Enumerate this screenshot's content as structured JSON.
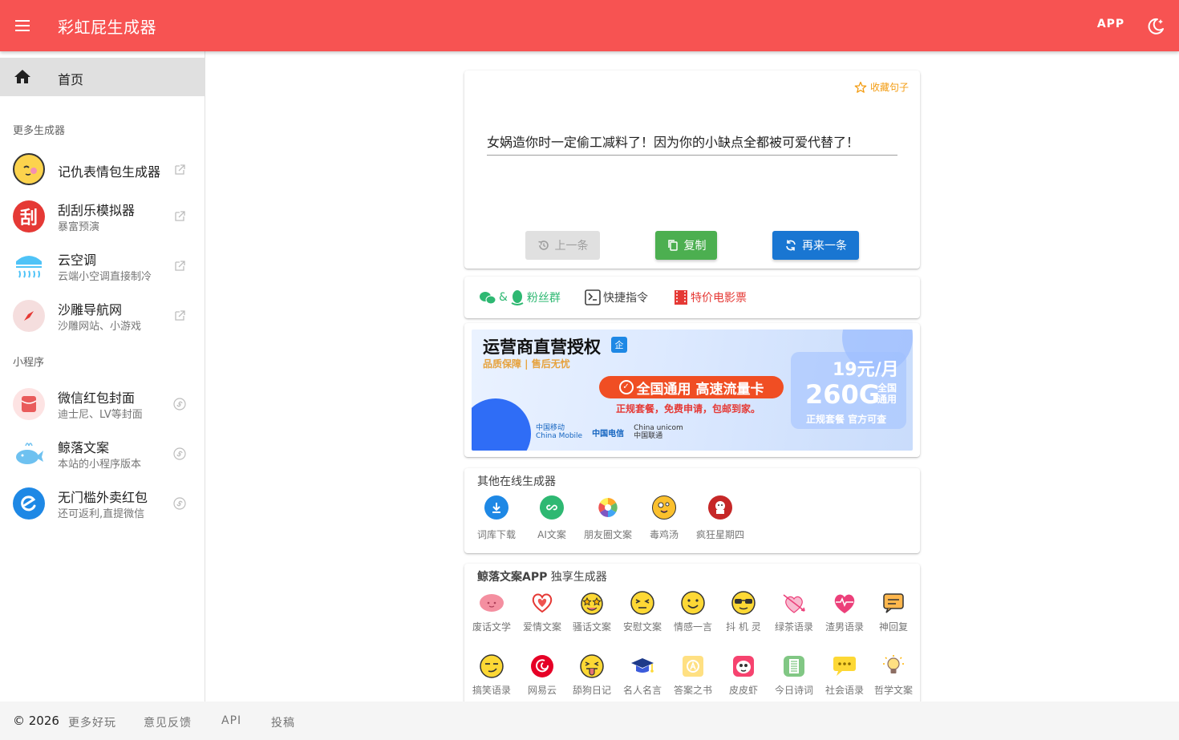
{
  "header": {
    "title": "彩虹屁生成器",
    "app_label": "APP"
  },
  "sidebar": {
    "home_label": "首页",
    "more_generators_header": "更多生成器",
    "generators": [
      {
        "title": "记仇表情包生成器",
        "sub": ""
      },
      {
        "title": "刮刮乐模拟器",
        "sub": "暴富预演",
        "avatar_text": "刮"
      },
      {
        "title": "云空调",
        "sub": "云端小空调直接制冷"
      },
      {
        "title": "沙雕导航网",
        "sub": "沙雕网站、小游戏"
      }
    ],
    "mini_programs_header": "小程序",
    "mini_programs": [
      {
        "title": "微信红包封面",
        "sub": "迪士尼、LV等封面"
      },
      {
        "title": "鲸落文案",
        "sub": "本站的小程序版本"
      },
      {
        "title": "无门槛外卖红包",
        "sub": "还可返利,直提微信"
      }
    ]
  },
  "main": {
    "favorite_label": "收藏句子",
    "sentence": "女娲造你时一定偷工减料了！因为你的小缺点全都被可爱代替了！",
    "prev_label": "上一条",
    "copy_label": "复制",
    "again_label": "再来一条",
    "links": {
      "fans_amp": "&",
      "fans_label": "粉丝群",
      "shortcut_label": "快捷指令",
      "movie_label": "特价电影票"
    }
  },
  "ad": {
    "headline": "运营商直营授权",
    "badge": "企",
    "guarantee": "品质保障 | 售后无忧",
    "pill": "全国通用 高速流量卡",
    "subline": "正规套餐，免费申请，包邮到家。",
    "price": "19元/月",
    "data_amount": "260G",
    "data_tag_1": "全国",
    "data_tag_2": "通用",
    "price_note": "正规套餐 官方可查",
    "carrier_1": "中国移动",
    "carrier_1_en": "China Mobile",
    "carrier_2": "中国电信",
    "carrier_3_en": "China unicom",
    "carrier_3": "中国联通"
  },
  "other_generators": {
    "title": "其他在线生成器",
    "items": [
      {
        "label": "词库下载",
        "icon": "download-icon",
        "color": "#1e88e5"
      },
      {
        "label": "AI文案",
        "icon": "link-icon",
        "color": "#2eb872"
      },
      {
        "label": "朋友圈文案",
        "icon": "pinwheel-icon",
        "color": "#ffa726"
      },
      {
        "label": "毒鸡汤",
        "icon": "crazy-face-icon",
        "color": "#fbc02d"
      },
      {
        "label": "疯狂星期四",
        "icon": "kfc-icon",
        "color": "#c62828"
      }
    ]
  },
  "app_generators": {
    "title_bold": "鲸落文案APP",
    "title_rest": " 独享生成器",
    "items": [
      {
        "label": "废话文学",
        "icon": "brain-icon"
      },
      {
        "label": "爱情文案",
        "icon": "heart-icon"
      },
      {
        "label": "骚话文案",
        "icon": "star-struck-icon"
      },
      {
        "label": "安慰文案",
        "icon": "squint-face-icon"
      },
      {
        "label": "情感一言",
        "icon": "smile-face-icon"
      },
      {
        "label": "抖 机 灵",
        "icon": "sunglasses-face-icon"
      },
      {
        "label": "绿茶语录",
        "icon": "arrow-heart-icon"
      },
      {
        "label": "渣男语录",
        "icon": "heartbeat-icon"
      },
      {
        "label": "神回复",
        "icon": "message-icon"
      },
      {
        "label": "搞笑语录",
        "icon": "smirk-face-icon"
      },
      {
        "label": "网易云",
        "icon": "netease-icon"
      },
      {
        "label": "舔狗日记",
        "icon": "tongue-face-icon"
      },
      {
        "label": "名人名言",
        "icon": "graduation-cap-icon"
      },
      {
        "label": "答案之书",
        "icon": "answer-book-icon"
      },
      {
        "label": "皮皮虾",
        "icon": "pipixia-icon"
      },
      {
        "label": "今日诗词",
        "icon": "poem-icon"
      },
      {
        "label": "社会语录",
        "icon": "chat-bubble-icon"
      },
      {
        "label": "哲学文案",
        "icon": "lightbulb-icon"
      }
    ]
  },
  "footer": {
    "copyright": "© 2026",
    "links": [
      "更多好玩",
      "意见反馈",
      "API",
      "投稿"
    ]
  },
  "colors": {
    "primary": "#f75352",
    "copy_green": "#4caf50",
    "again_blue": "#1976d2",
    "favorite_orange": "#f39c12",
    "fans_green": "#2eb872",
    "movie_red": "#e53935"
  }
}
